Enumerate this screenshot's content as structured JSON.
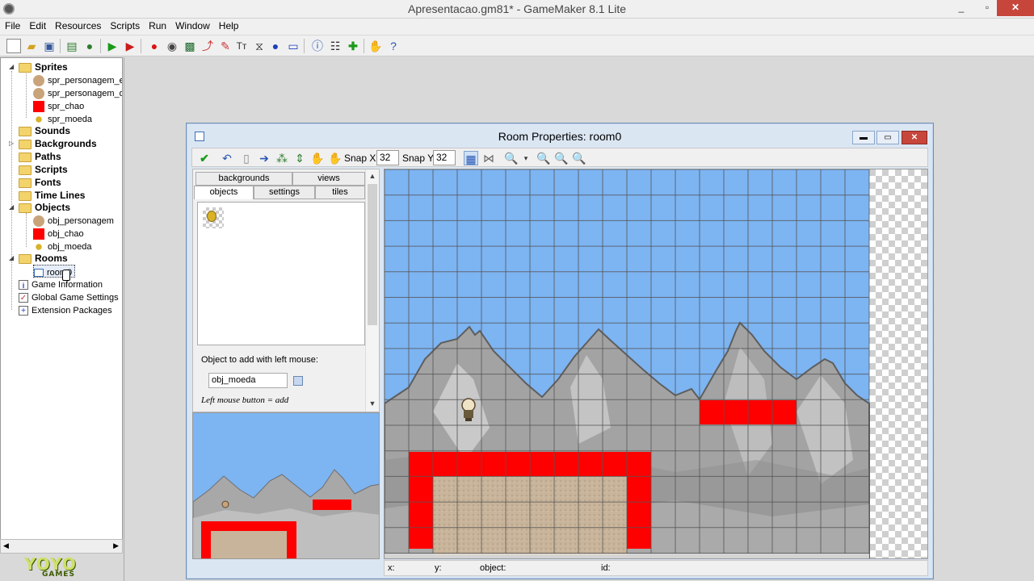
{
  "window": {
    "title": "Apresentacao.gm81* - GameMaker 8.1 Lite",
    "minimize": "_",
    "maximize": "▫",
    "close": "✕"
  },
  "menu": [
    "File",
    "Edit",
    "Resources",
    "Scripts",
    "Run",
    "Window",
    "Help"
  ],
  "tree": {
    "sprites": "Sprites",
    "spr_personagem_es": "spr_personagem_es",
    "spr_personagem_dir": "spr_personagem_dir",
    "spr_chao": "spr_chao",
    "spr_moeda": "spr_moeda",
    "sounds": "Sounds",
    "backgrounds": "Backgrounds",
    "paths": "Paths",
    "scripts": "Scripts",
    "fonts": "Fonts",
    "timelines": "Time Lines",
    "objects": "Objects",
    "obj_personagem": "obj_personagem",
    "obj_chao": "obj_chao",
    "obj_moeda": "obj_moeda",
    "rooms": "Rooms",
    "room0": "room0",
    "game_information": "Game Information",
    "global_game_settings": "Global Game Settings",
    "extension_packages": "Extension Packages"
  },
  "logo": {
    "brand": "YOYO",
    "sub": "GAMES"
  },
  "room_window": {
    "title": "Room Properties: room0",
    "snap_x_label": "Snap X:",
    "snap_x": "32",
    "snap_y_label": "Snap Y:",
    "snap_y": "32",
    "tabs": {
      "backgrounds": "backgrounds",
      "views": "views",
      "objects": "objects",
      "settings": "settings",
      "tiles": "tiles"
    },
    "object_to_add_label": "Object to add with left mouse:",
    "object_to_add": "obj_moeda",
    "hint": "Left mouse button = add",
    "status": {
      "x": "x:",
      "y": "y:",
      "object": "object:",
      "id": "id:"
    }
  },
  "colors": {
    "sky": "#7db4f2",
    "ground_red": "#ff0000",
    "sand": "#c8b49a",
    "mountain": "#a8a8a8",
    "grid": "#555555"
  },
  "icons": [
    "new-icon",
    "open-icon",
    "save-icon",
    "create-exe-icon",
    "publish-icon",
    "run-icon",
    "debug-icon",
    "sprite-icon",
    "sound-icon",
    "background-icon",
    "path-icon",
    "script-icon",
    "font-icon",
    "timeline-icon",
    "object-icon",
    "room-icon",
    "game-info-icon",
    "settings-icon",
    "extension-icon",
    "help-icon",
    "hand-icon"
  ]
}
